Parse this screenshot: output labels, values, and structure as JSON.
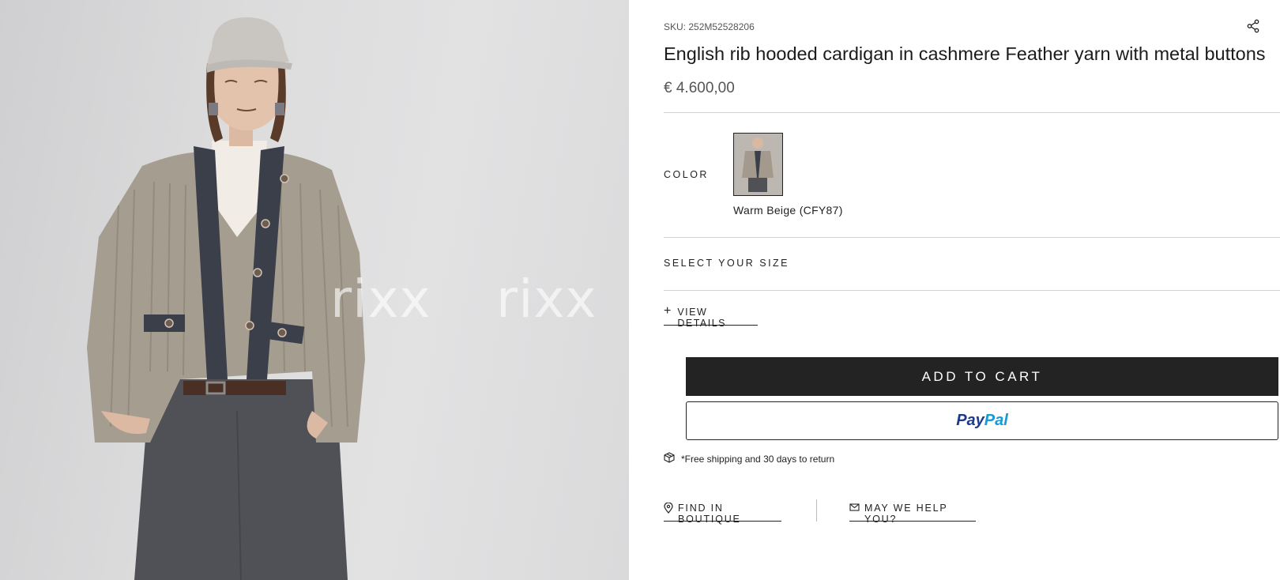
{
  "product": {
    "sku": "SKU: 252M52528206",
    "title": "English rib hooded cardigan in cashmere Feather yarn with metal buttons",
    "price": "€ 4.600,00"
  },
  "image": {
    "watermarks": [
      "rixx",
      "rixx"
    ]
  },
  "color": {
    "label": "COLOR",
    "selected_name": "Warm Beige (CFY87)"
  },
  "size": {
    "label": "SELECT YOUR SIZE"
  },
  "details": {
    "label": "VIEW DETAILS",
    "icon": "plus-icon"
  },
  "actions": {
    "add_to_cart": "ADD TO CART",
    "paypal_part1": "Pay",
    "paypal_part2": "Pal"
  },
  "shipping": {
    "text": "*Free shipping and 30 days to return",
    "icon": "box-icon"
  },
  "links": {
    "boutique": "FIND IN BOUTIQUE",
    "boutique_icon": "location-pin-icon",
    "help": "MAY WE HELP YOU?",
    "help_icon": "envelope-icon"
  },
  "colors": {
    "button_bg": "#232323",
    "paypal_dark": "#1f3a8a",
    "paypal_light": "#179bd7"
  }
}
